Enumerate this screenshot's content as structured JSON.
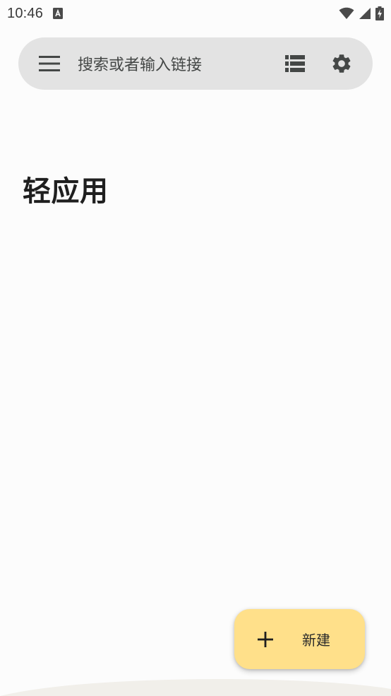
{
  "status_bar": {
    "time": "10:46",
    "notification_icon": "a-box-icon",
    "icons": [
      "wifi-icon",
      "signal-icon",
      "battery-charging-icon"
    ]
  },
  "search": {
    "placeholder": "搜索或者输入链接",
    "menu_icon": "menu-icon",
    "list_icon": "list-view-icon",
    "settings_icon": "gear-icon"
  },
  "main": {
    "section_title": "轻应用"
  },
  "fab": {
    "icon": "plus-icon",
    "label": "新建"
  },
  "colors": {
    "background": "#fcfcfc",
    "search_bar": "#e3e3e3",
    "fab": "#ffe08a",
    "icon": "#444746"
  }
}
